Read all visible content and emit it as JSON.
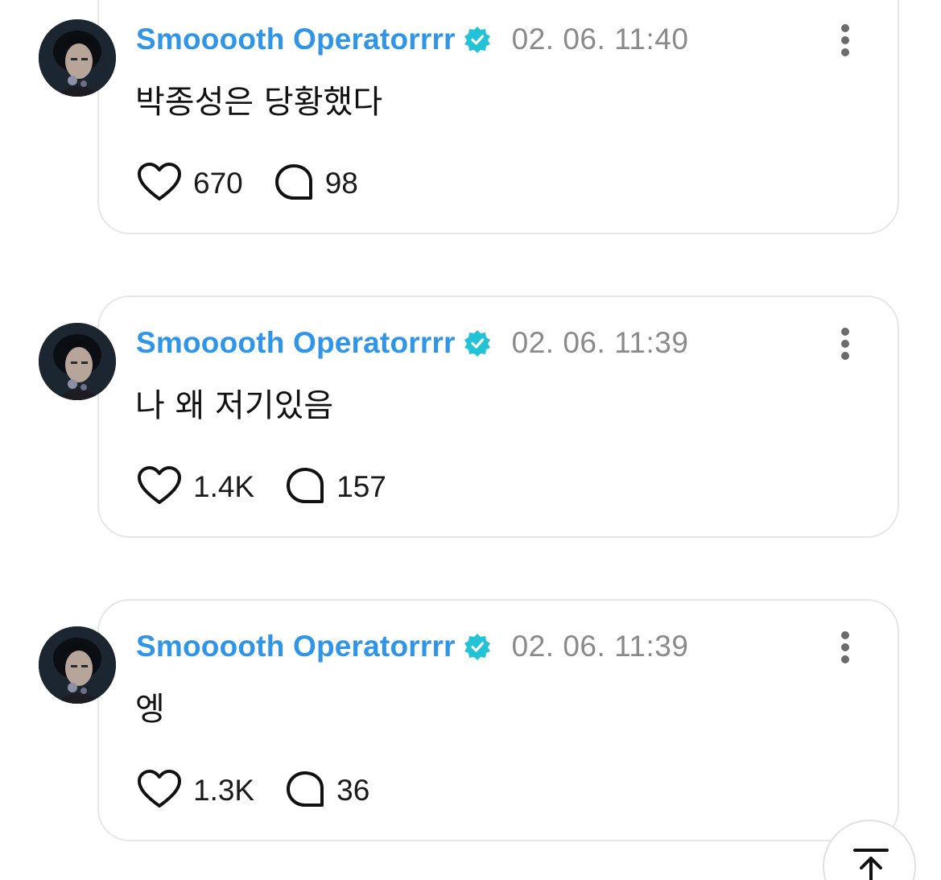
{
  "colors": {
    "username": "#2f95e8",
    "verified_badge": "#22c3d6",
    "timestamp": "#8a8a8a",
    "card_border": "#e6e6e6"
  },
  "posts": [
    {
      "username": "Smooooth Operatorrrr",
      "verified_icon": "verified-badge-icon",
      "timestamp": "02. 06. 11:40",
      "text": "박종성은 당황했다",
      "likes": "670",
      "replies": "98"
    },
    {
      "username": "Smooooth Operatorrrr",
      "verified_icon": "verified-badge-icon",
      "timestamp": "02. 06. 11:39",
      "text": "나 왜 저기있음",
      "likes": "1.4K",
      "replies": "157"
    },
    {
      "username": "Smooooth Operatorrrr",
      "verified_icon": "verified-badge-icon",
      "timestamp": "02. 06. 11:39",
      "text": "엥",
      "likes": "1.3K",
      "replies": "36"
    }
  ],
  "icons": {
    "like": "heart-icon",
    "reply": "speech-bubble-icon",
    "more": "more-vertical-icon",
    "scroll_top": "arrow-up-to-top-icon"
  }
}
